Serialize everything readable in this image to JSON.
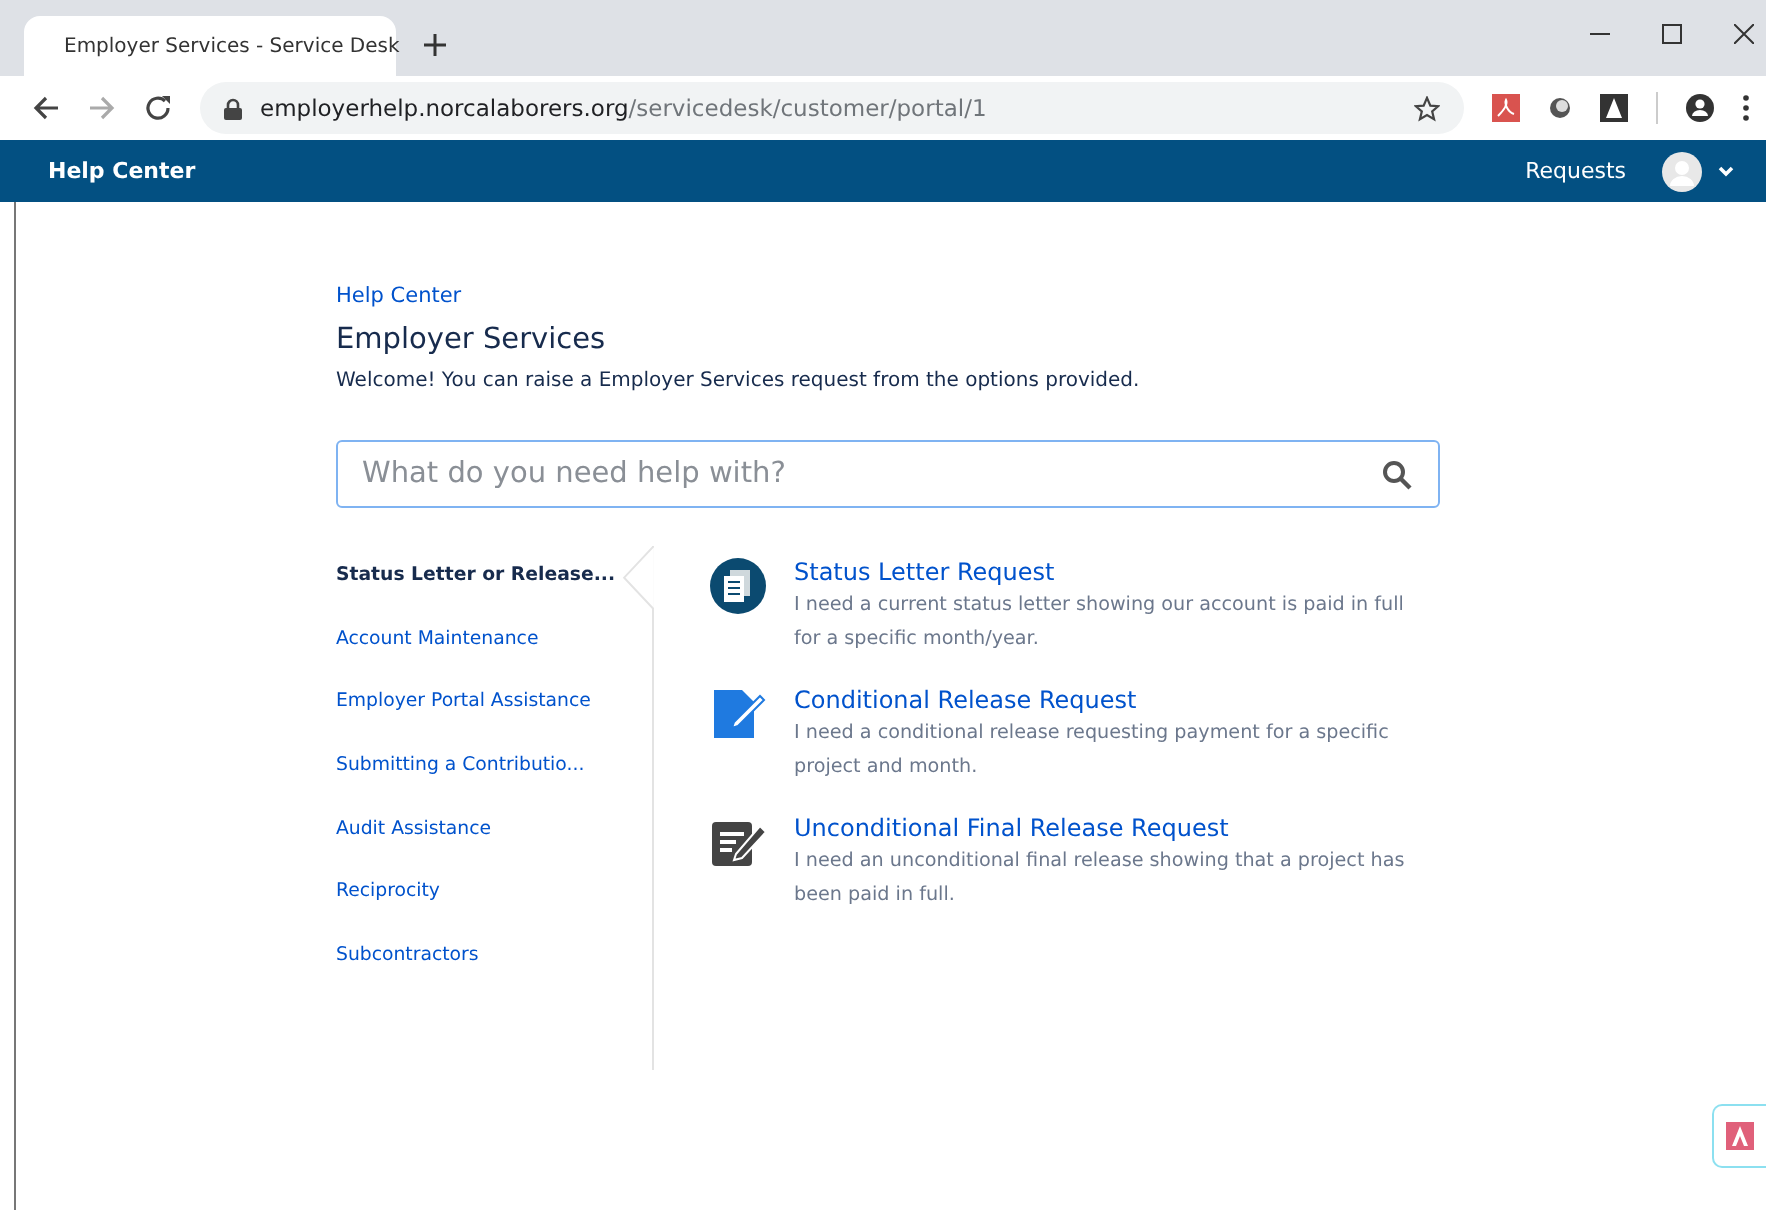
{
  "browser": {
    "tab_title": "Employer Services - Service Desk",
    "url_host": "employerhelp.norcalaborers.org",
    "url_path": "/servicedesk/customer/portal/1"
  },
  "header": {
    "title": "Help Center",
    "requests": "Requests"
  },
  "breadcrumb": "Help Center",
  "title": "Employer Services",
  "welcome": "Welcome! You can raise a Employer Services request from the options provided.",
  "search": {
    "placeholder": "What do you need help with?"
  },
  "categories": [
    {
      "label": "Status Letter or Release...",
      "selected": true
    },
    {
      "label": "Account Maintenance",
      "selected": false
    },
    {
      "label": "Employer Portal Assistance",
      "selected": false
    },
    {
      "label": "Submitting a Contributio...",
      "selected": false
    },
    {
      "label": "Audit Assistance",
      "selected": false
    },
    {
      "label": "Reciprocity",
      "selected": false
    },
    {
      "label": "Subcontractors",
      "selected": false
    }
  ],
  "request_types": [
    {
      "kind": "documents",
      "title": "Status Letter Request",
      "description": "I need a current status letter showing our account is paid in full for a specific month/year."
    },
    {
      "kind": "edit",
      "title": "Conditional Release Request",
      "description": "I need a conditional release requesting payment for a specific project and month."
    },
    {
      "kind": "form",
      "title": "Unconditional Final Release Request",
      "description": "I need an unconditional final release showing that a project has been paid in full."
    }
  ]
}
